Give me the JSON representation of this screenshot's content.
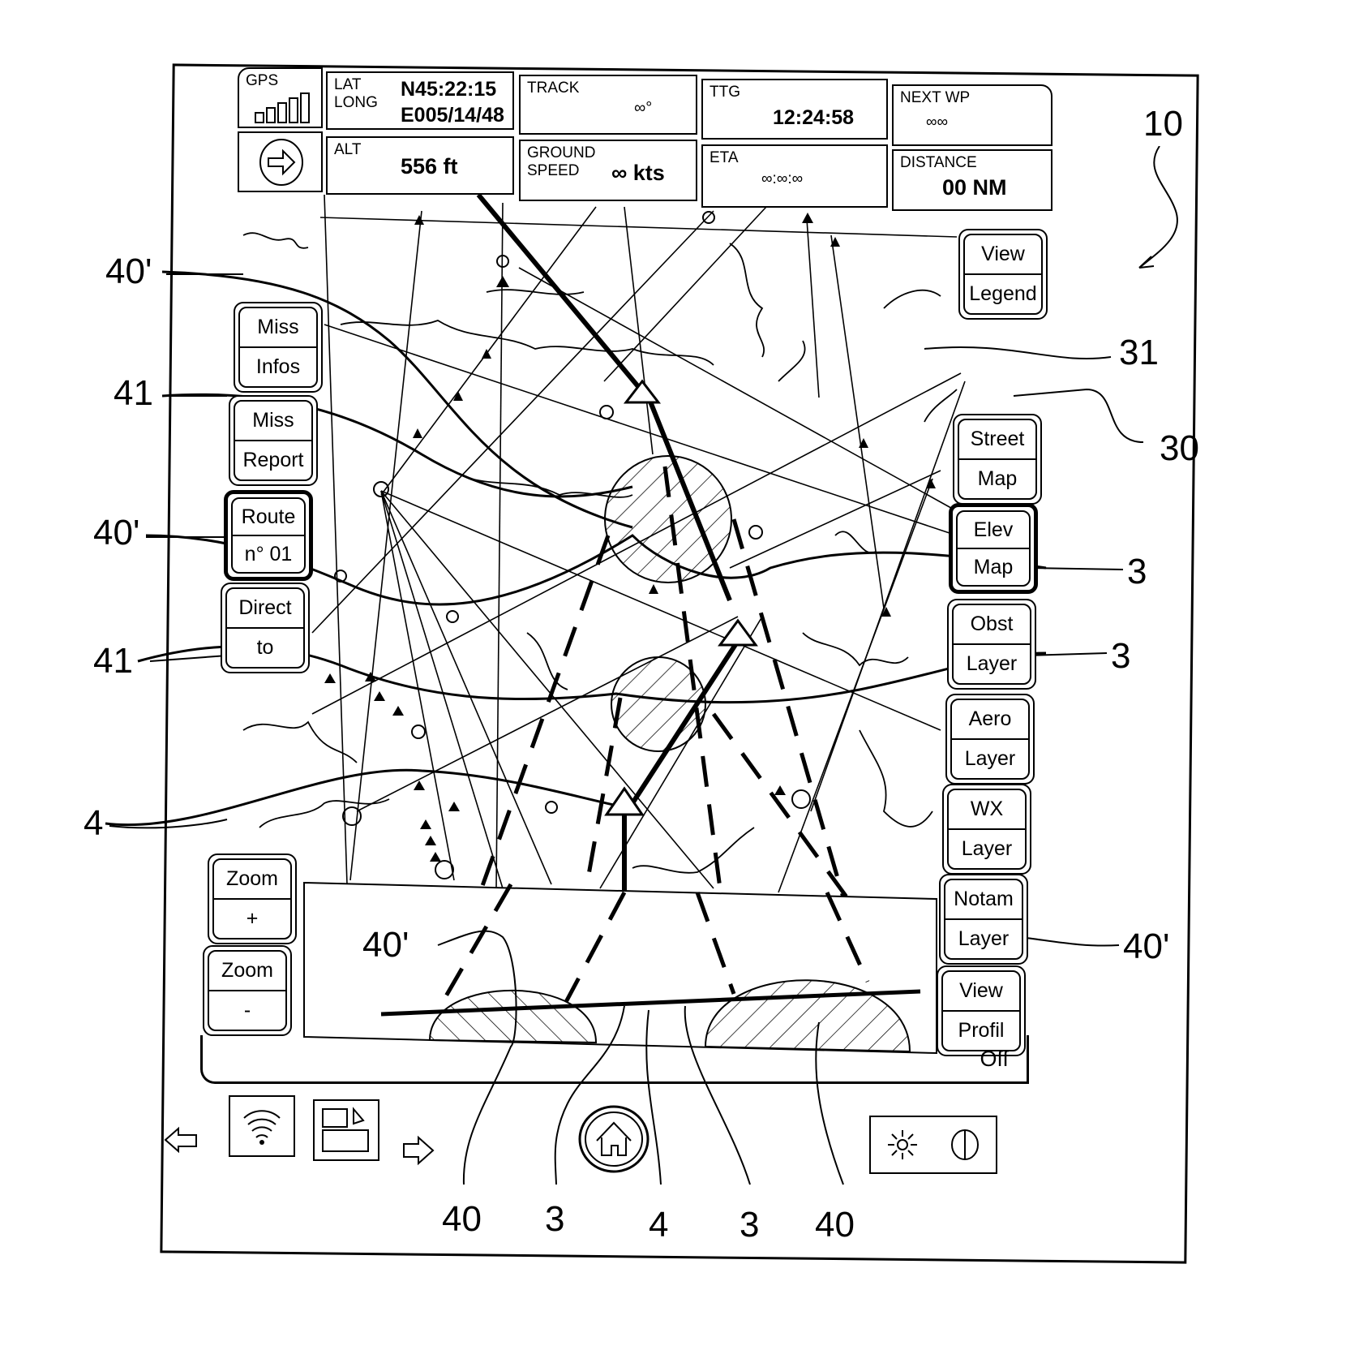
{
  "figure_ref": "10",
  "status_panel": {
    "gps": {
      "label": "GPS",
      "signal_bars_filled": 1,
      "signal_bars_total": 5
    },
    "direct_button": {
      "icon": "arrow-right-circle-icon"
    },
    "latlong": {
      "label_lat": "LAT",
      "label_long": "LONG",
      "lat": "N45:22:15",
      "long": "E005/14/48"
    },
    "alt": {
      "label": "ALT",
      "value": "556 ft"
    },
    "track": {
      "label": "TRACK",
      "value": "∞°"
    },
    "ground_speed": {
      "label_1": "GROUND",
      "label_2": "SPEED",
      "value": "∞ kts"
    },
    "ttg": {
      "label": "TTG",
      "value": "12:24:58"
    },
    "eta": {
      "label": "ETA",
      "value": "∞:∞:∞"
    },
    "next_wp": {
      "label": "NEXT WP",
      "value": "∞∞"
    },
    "distance": {
      "label": "DISTANCE",
      "value": "00 NM"
    }
  },
  "left_buttons": [
    {
      "l1": "Miss",
      "l2": "Infos",
      "active": false
    },
    {
      "l1": "Miss",
      "l2": "Report",
      "active": false
    },
    {
      "l1": "Route",
      "l2": "n° 01",
      "active": true
    },
    {
      "l1": "Direct",
      "l2": "to",
      "active": false
    }
  ],
  "zoom_buttons": [
    {
      "l1": "Zoom",
      "l2": "+"
    },
    {
      "l1": "Zoom",
      "l2": "-"
    }
  ],
  "right_buttons": [
    {
      "l1": "View",
      "l2": "Legend",
      "active": false
    },
    {
      "l1": "Street",
      "l2": "Map",
      "active": false
    },
    {
      "l1": "Elev",
      "l2": "Map",
      "active": true
    },
    {
      "l1": "Obst",
      "l2": "Layer",
      "active": false
    },
    {
      "l1": "Aero",
      "l2": "Layer",
      "active": false
    },
    {
      "l1": "WX",
      "l2": "Layer",
      "active": false
    },
    {
      "l1": "Notam",
      "l2": "Layer",
      "active": false
    },
    {
      "l1": "View",
      "l2": "Profil",
      "active": false
    }
  ],
  "profile_bar": {
    "off_label": "Off"
  },
  "bottom_bar": {
    "back_icon": "arrow-left-icon",
    "wifi_icon": "wireless-icon",
    "window_icon": "windows-icon",
    "forward_icon": "arrow-right-icon",
    "home_icon": "home-icon",
    "brightness_icon": "sun-icon",
    "power_icon": "power-icon"
  },
  "reference_labels": {
    "left": [
      "40'",
      "41",
      "40'",
      "41",
      "4"
    ],
    "right": [
      "31",
      "30",
      "3",
      "3",
      "40'"
    ],
    "profile": [
      "40'"
    ],
    "bottom": [
      "40",
      "3",
      "4",
      "3",
      "40"
    ]
  }
}
